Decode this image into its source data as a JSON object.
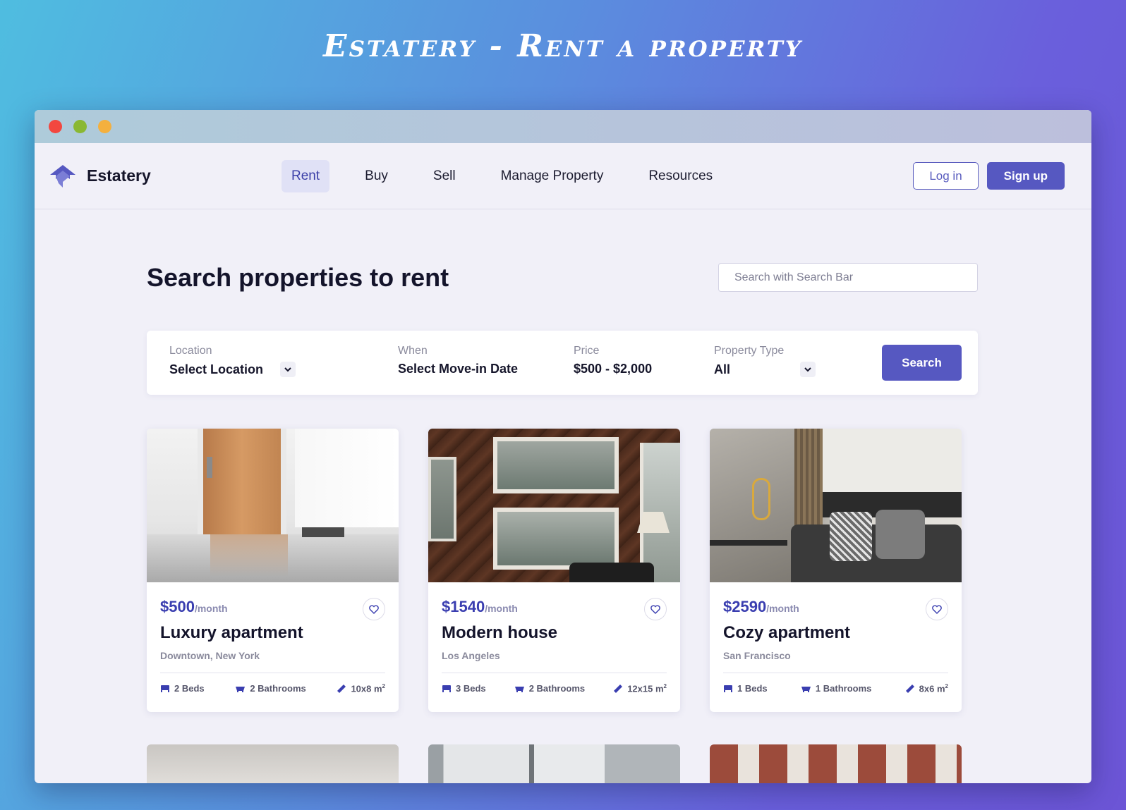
{
  "page_heading": "Estatery - Rent a property",
  "window": {
    "traffic_lights": [
      "#f2473f",
      "#8ab833",
      "#f4b03e"
    ]
  },
  "nav": {
    "brand": "Estatery",
    "links": [
      "Rent",
      "Buy",
      "Sell",
      "Manage Property",
      "Resources"
    ],
    "active": "Rent",
    "login_label": "Log in",
    "signup_label": "Sign up"
  },
  "main": {
    "headline": "Search properties to rent",
    "search_placeholder": "Search with Search Bar"
  },
  "filters": {
    "location": {
      "label": "Location",
      "value": "Select Location"
    },
    "when": {
      "label": "When",
      "value": "Select Move-in Date"
    },
    "price": {
      "label": "Price",
      "value": "$500 - $2,000"
    },
    "property_type": {
      "label": "Property Type",
      "value": "All"
    },
    "search_label": "Search"
  },
  "listings": [
    {
      "price": "$500",
      "period": "/month",
      "title": "Luxury apartment",
      "location": "Downtown, New York",
      "beds": "2 Beds",
      "baths": "2 Bathrooms",
      "area": "10x8 m",
      "area_sup": "2"
    },
    {
      "price": "$1540",
      "period": "/month",
      "title": "Modern house",
      "location": "Los Angeles",
      "beds": "3 Beds",
      "baths": "2 Bathrooms",
      "area": "12x15 m",
      "area_sup": "2"
    },
    {
      "price": "$2590",
      "period": "/month",
      "title": "Cozy apartment",
      "location": "San Francisco",
      "beds": "1 Beds",
      "baths": "1 Bathrooms",
      "area": "8x6 m",
      "area_sup": "2"
    }
  ],
  "colors": {
    "accent": "#5658c1",
    "price": "#3a3eb0",
    "text_dark": "#14142b"
  }
}
